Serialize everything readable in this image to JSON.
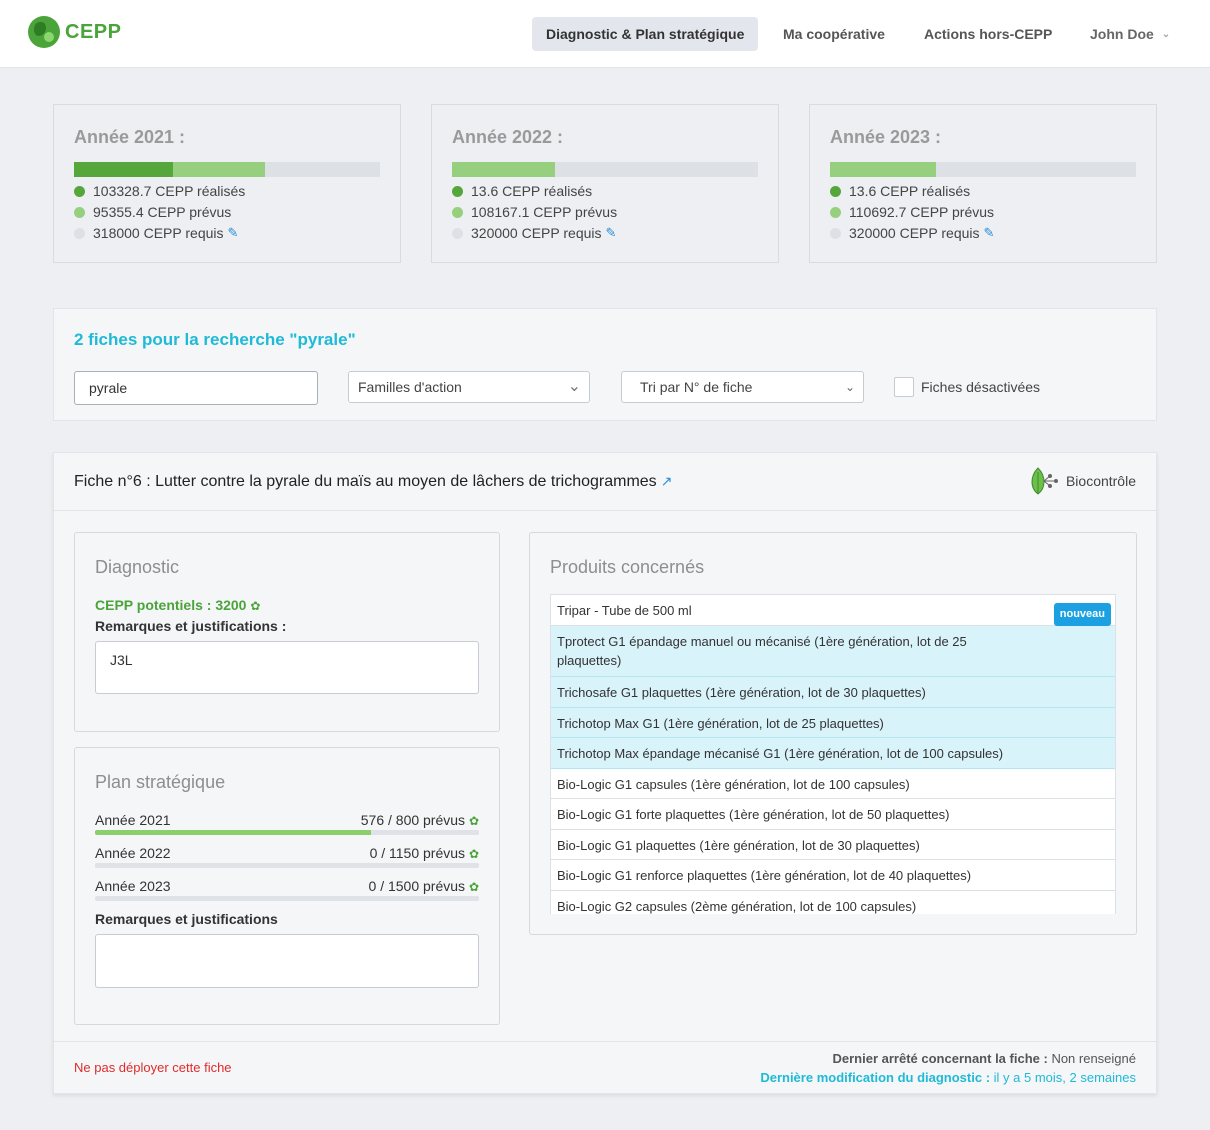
{
  "brand": {
    "name": "CEPP"
  },
  "nav": {
    "items": [
      "Diagnostic & Plan stratégique",
      "Ma coopérative",
      "Actions hors-CEPP"
    ],
    "user": "John Doe"
  },
  "years": [
    {
      "title": "Année 2021 :",
      "realised": "103328.7 CEPP réalisés",
      "planned": "95355.4 CEPP prévus",
      "required": "318000 CEPP requis",
      "realised_fraction": 0.325,
      "planned_fraction": 0.3
    },
    {
      "title": "Année 2022 :",
      "realised": "13.6 CEPP réalisés",
      "planned": "108167.1 CEPP prévus",
      "required": "320000 CEPP requis",
      "realised_fraction": 0.0,
      "planned_fraction": 0.338
    },
    {
      "title": "Année 2023 :",
      "realised": "13.6 CEPP réalisés",
      "planned": "110692.7 CEPP prévus",
      "required": "320000 CEPP requis",
      "realised_fraction": 0.0,
      "planned_fraction": 0.346
    }
  ],
  "search": {
    "title": "2 fiches pour la recherche \"pyrale\"",
    "value": "pyrale",
    "family_select": "Familles d'action",
    "sort_select": "Tri par N° de fiche",
    "disabled_label": "Fiches désactivées"
  },
  "fiche": {
    "title": "Fiche n°6 : Lutter contre la pyrale du maïs au moyen de lâchers de trichogrammes",
    "category": "Biocontrôle",
    "diagnostic": {
      "title": "Diagnostic",
      "potential": "CEPP potentiels : 3200",
      "remarks_label": "Remarques et justifications :",
      "remarks_value": "J3L"
    },
    "plan": {
      "title": "Plan stratégique",
      "rows": [
        {
          "year": "Année 2021",
          "value": "576 / 800 prévus",
          "fraction": 0.72
        },
        {
          "year": "Année 2022",
          "value": "0 / 1150 prévus",
          "fraction": 0
        },
        {
          "year": "Année 2023",
          "value": "0 / 1500 prévus",
          "fraction": 0
        }
      ],
      "remarks_label": "Remarques et justifications"
    },
    "products": {
      "title": "Produits concernés",
      "new_badge": "nouveau",
      "items": [
        {
          "name": "Tripar - Tube de 500 ml",
          "highlight": false
        },
        {
          "name": "Tprotect G1 épandage manuel ou mécanisé (1ère génération, lot de 25 plaquettes)",
          "highlight": true
        },
        {
          "name": "Trichosafe G1 plaquettes (1ère génération, lot de 30 plaquettes)",
          "highlight": true
        },
        {
          "name": "Trichotop Max G1 (1ère génération, lot de 25 plaquettes)",
          "highlight": true
        },
        {
          "name": "Trichotop Max épandage mécanisé G1 (1ère génération, lot de 100 capsules)",
          "highlight": true
        },
        {
          "name": "Bio-Logic G1 capsules (1ère génération, lot de 100 capsules)",
          "highlight": false
        },
        {
          "name": "Bio-Logic G1 forte plaquettes (1ère génération, lot de 50 plaquettes)",
          "highlight": false
        },
        {
          "name": "Bio-Logic G1 plaquettes (1ère génération, lot de 30 plaquettes)",
          "highlight": false
        },
        {
          "name": "Bio-Logic G1 renforce plaquettes (1ère génération, lot de 40 plaquettes)",
          "highlight": false
        },
        {
          "name": "Bio-Logic G2 capsules (2ème génération, lot de 100 capsules)",
          "highlight": false
        }
      ]
    },
    "footer": {
      "danger_link": "Ne pas déployer cette fiche",
      "last_decree_label": "Dernier arrêté concernant la fiche :",
      "last_decree_value": "Non renseigné",
      "last_modif_label": "Dernière modification du diagnostic :",
      "last_modif_value": "il y a 5 mois, 2 semaines"
    }
  },
  "colors": {
    "accent": "#1fbad6",
    "green": "#4aa43a",
    "light_green": "#96cf7d",
    "danger": "#e02b2b",
    "badge": "#1ba1e2"
  }
}
